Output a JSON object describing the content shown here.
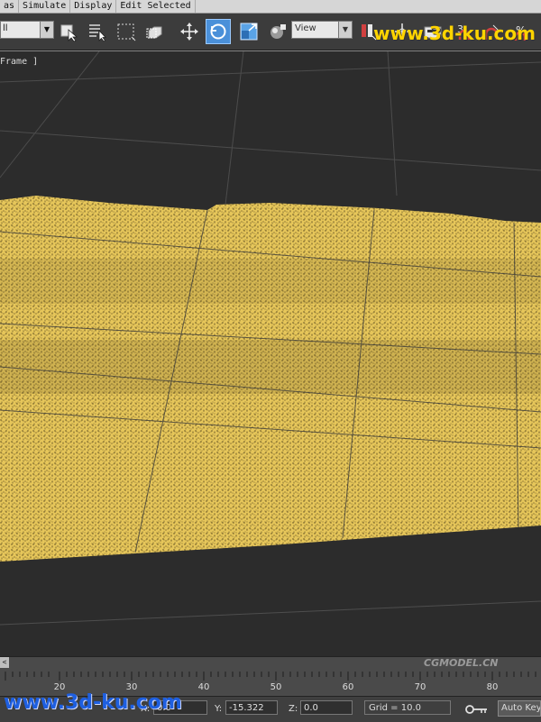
{
  "menu": {
    "items": [
      "as",
      "Simulate",
      "Display",
      "Edit Selected"
    ]
  },
  "toolbar": {
    "selection_filter": "ll",
    "reference_coord": "View",
    "icons": [
      "select-object-icon",
      "select-by-name-icon",
      "rect-select-region-icon",
      "window-crossing-icon",
      "move-icon",
      "rotate-icon",
      "scale-icon",
      "select-manipulate-icon",
      "pivot-center-icon",
      "select-manipulate-icon",
      "keyboard-shortcut-icon",
      "snap-icon",
      "angle-snap-icon",
      "percent-snap-icon"
    ]
  },
  "watermarks": {
    "top": "www.3d-ku.com",
    "bottom": "www.3d-ku.com",
    "cg_small": "CGMODEL.CN"
  },
  "viewport": {
    "label": "Frame ]",
    "background": "#2c2c2c",
    "terrain_color": "#e6c65a",
    "grid_color": "#555555"
  },
  "timeline": {
    "frame_button": "<",
    "tick_labels": [
      "20",
      "30",
      "40",
      "50",
      "60",
      "70",
      "80"
    ]
  },
  "status": {
    "x_label": "X:",
    "x_value": "0.0",
    "y_label": "Y:",
    "y_value": "-15.322",
    "z_label": "Z:",
    "z_value": "0.0",
    "grid": "Grid = 10.0",
    "autokey": "Auto Key"
  }
}
